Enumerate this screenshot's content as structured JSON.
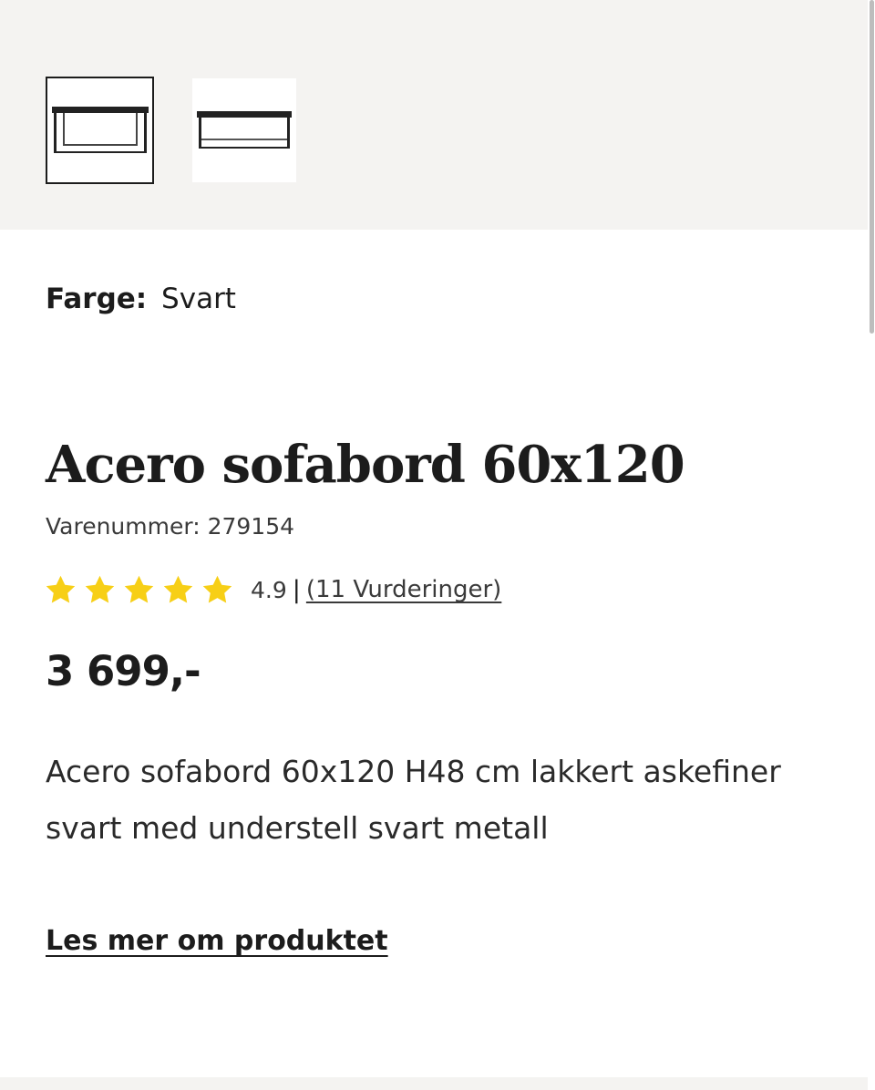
{
  "gallery": {
    "thumbnails": [
      {
        "icon": "table-thumbnail-icon",
        "selected": true
      },
      {
        "icon": "table-thumbnail-icon",
        "selected": false
      }
    ]
  },
  "color": {
    "label": "Farge:",
    "value": "Svart"
  },
  "product": {
    "title": "Acero sofabord 60x120",
    "sku": "Varenummer: 279154",
    "rating": {
      "stars": 5,
      "score": "4.9",
      "separator": "|",
      "reviews_link": "(11 Vurderinger)"
    },
    "price": "3 699,-",
    "description": "Acero sofabord 60x120 H48 cm lakkert askefiner svart med understell svart metall",
    "read_more": "Les mer om produktet"
  },
  "colors": {
    "star": "#f7cf16",
    "text": "#1c1c1c",
    "gallery_bg": "#f4f3f1"
  }
}
